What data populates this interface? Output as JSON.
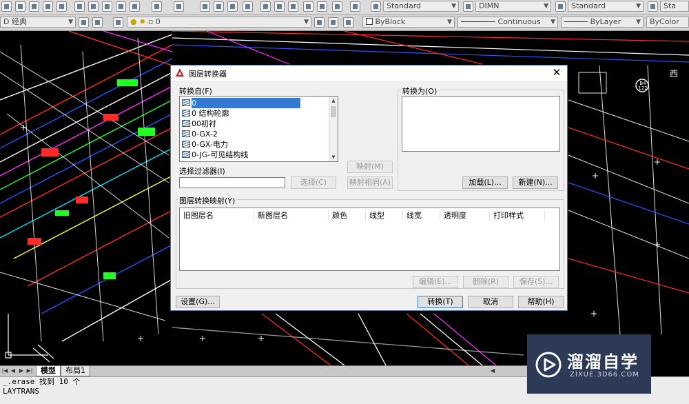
{
  "toolbar_top": {
    "text_style": "Standard",
    "dim_style": "DIMN",
    "table_style": "Standard",
    "mleader_style": "Sta"
  },
  "toolbar_layers": {
    "workspace": "D 经典",
    "current_layer": "0",
    "color": "ByBlock",
    "linetype": "Continuous",
    "lineweight": "ByLayer",
    "plotstyle": "ByColor"
  },
  "dialog": {
    "title": "图层转换器",
    "from_label": "转换自(F)",
    "to_label": "转换为(O)",
    "from_layers": [
      "0",
      "0 结构轮廓",
      "00初衬",
      "0-GX-2",
      "0-GX-电力",
      "0-JG-可见结构线"
    ],
    "filter_label": "选择过滤器(I)",
    "filter_value": "",
    "select_button": "选择(C)",
    "map_button": "映射(M)",
    "map_same_button": "映射相同(A)",
    "load_button": "加载(L)...",
    "new_button": "新建(N)...",
    "mapping_label": "图层转换映射(Y)",
    "columns": [
      "旧图层名",
      "新图层名",
      "颜色",
      "线型",
      "线宽",
      "透明度",
      "打印样式"
    ],
    "edit_button": "编辑(E)...",
    "delete_button": "删除(R)",
    "save_button": "保存(S)...",
    "settings_button": "设置(G)...",
    "translate_button": "转换(T)",
    "cancel_button": "取消",
    "help_button": "帮助(H)"
  },
  "tabs": {
    "model": "模型",
    "layout1": "布局1"
  },
  "command_line": {
    "line1": "_.erase 找到 10 个",
    "line2": "LAYTRANS"
  },
  "drawing_labels": {
    "west": "西",
    "tag": "B4 122"
  },
  "watermark": {
    "title": "溜溜自学",
    "url": "ZIXUE.3D66.COM"
  },
  "colors": {
    "accent": "#3379d1",
    "canvas": "#000000",
    "watermark_bg": "#2c3a57"
  }
}
